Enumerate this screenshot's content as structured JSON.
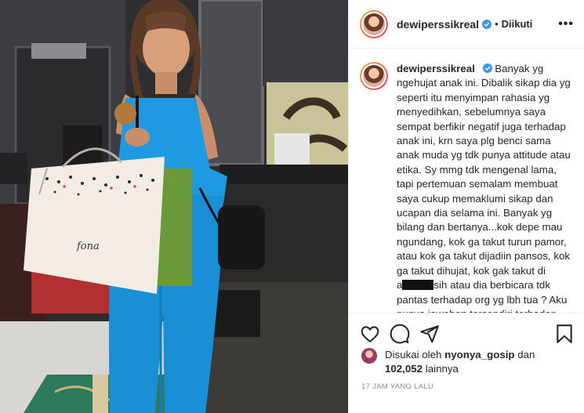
{
  "post": {
    "username": "dewiperssikreal",
    "follow_status": "Diikuti",
    "more_label": "•••",
    "caption_body": "Banyak yg ngehujat anak ini. Dibalik sikap dia yg seperti itu menyimpan rahasia yg menyedihkan, sebelumnya saya sempat berfikir negatif juga terhadap anak ini, krn saya plg benci sama anak muda yg tdk punya attitude atau etika. Sy mmg tdk mengenal lama, tapi pertemuan semalam membuat saya cukup memaklumi sikap dan ucapan dia selama ini. Banyak yg bilang dan bertanya...kok depe mau ngundang, kok ga takut turun pamor, atau kok ga takut dijadiin pansos, kok ga takut dihujat, kok gak takut di",
    "caption_body_2": "sih atau dia berbicara tdk pantas terhadap org yg lbh tua ? Aku punya jawaban tersendiri terhadap anak ini, aku lbh liat ke positifnya drpd",
    "caption_redacted_prefix": "a",
    "likes_prefix": "Disukai oleh",
    "likes_user": "nyonya_gosip",
    "likes_conj": "dan",
    "likes_count": "102,052",
    "likes_suffix": "lainnya",
    "timestamp": "17 JAM YANG LALU"
  },
  "icons": {
    "like": "heart-icon",
    "comment": "comment-icon",
    "share": "share-icon",
    "save": "bookmark-icon",
    "verified": "verified-badge-icon"
  },
  "colors": {
    "text": "#262626",
    "muted": "#8e8e8e",
    "verified_blue": "#3897f0",
    "border": "#efefef"
  }
}
